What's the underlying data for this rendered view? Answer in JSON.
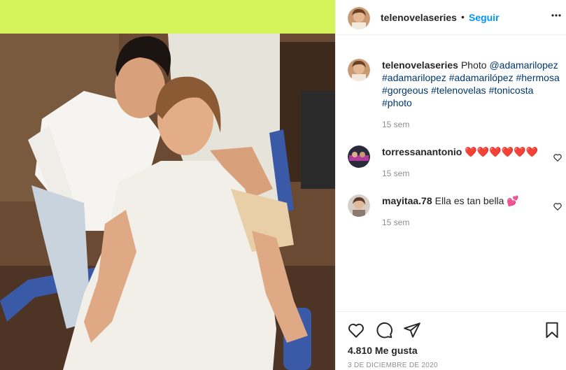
{
  "post": {
    "author": "telenovelaseries",
    "separator": "•",
    "follow_label": "Seguir",
    "caption": {
      "username": "telenovelaseries",
      "prefix": "Photo",
      "mention": "@adamarilopez",
      "hashtags": [
        "#adamarilopez",
        "#adamarilópez",
        "#hermosa",
        "#gorgeous",
        "#telenovelas",
        "#tonicosta",
        "#photo"
      ],
      "time": "15 sem"
    },
    "comments": [
      {
        "username": "torressanantonio",
        "text": "❤️❤️❤️❤️❤️❤️",
        "time": "15 sem"
      },
      {
        "username": "mayitaa.78",
        "text": "Ella es tan bella 💕",
        "time": "15 sem"
      }
    ],
    "likes": "4.810 Me gusta",
    "date": "3 DE DICIEMBRE DE 2020"
  },
  "icons": {
    "more": "more-dots-icon",
    "like": "heart-icon",
    "comment": "comment-bubble-icon",
    "share": "paper-plane-icon",
    "save": "bookmark-icon"
  },
  "colors": {
    "follow": "#0095f6",
    "link": "#00376b",
    "muted": "#8e8e8e",
    "border": "#efefef",
    "photo_banner": "#d5f45a"
  }
}
